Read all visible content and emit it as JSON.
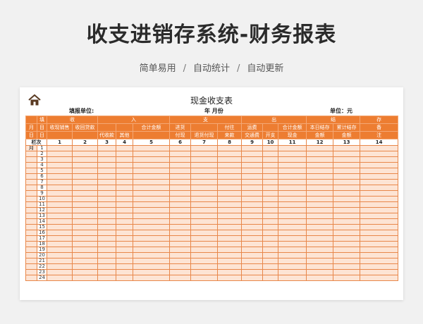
{
  "header": {
    "title": "收支进销存系统-财务报表",
    "subtitle": [
      "简单易用",
      "自动统计",
      "自动更新"
    ],
    "separator": "/"
  },
  "sheet": {
    "title": "现金收支表",
    "fill_unit": "填报单位:",
    "year_month": "年    月份",
    "unit": "单位：元",
    "icon": "home-icon"
  },
  "table": {
    "row1": [
      "",
      "填",
      "收",
      "入",
      "支",
      "出",
      "结",
      "存"
    ],
    "row2": [
      "月",
      "目",
      "收现销售",
      "收回贷款",
      "",
      "",
      "合计金额",
      "进货",
      "",
      "付往",
      "运费",
      "",
      "合计金额",
      "本日结存",
      "累计结存",
      "备"
    ],
    "row3": [
      "日",
      "日",
      "",
      "",
      "代收款",
      "其他",
      "",
      "付现",
      "退货付现",
      "来款",
      "交通费",
      "开支",
      "现金",
      "金额",
      "金额",
      "注"
    ],
    "num_header": [
      "栏次",
      "1",
      "2",
      "3",
      "4",
      "5",
      "6",
      "7",
      "8",
      "9",
      "10",
      "11",
      "12",
      "13",
      "14"
    ],
    "month_label": "月",
    "rows": [
      "1",
      "2",
      "3",
      "4",
      "5",
      "6",
      "7",
      "8",
      "9",
      "10",
      "11",
      "12",
      "13",
      "14",
      "15",
      "16",
      "17",
      "18",
      "19",
      "20",
      "21",
      "22",
      "23",
      "24"
    ]
  },
  "colors": {
    "accent": "#ed7d31",
    "row_fill": "#fde4d4",
    "border": "#e8874a"
  }
}
